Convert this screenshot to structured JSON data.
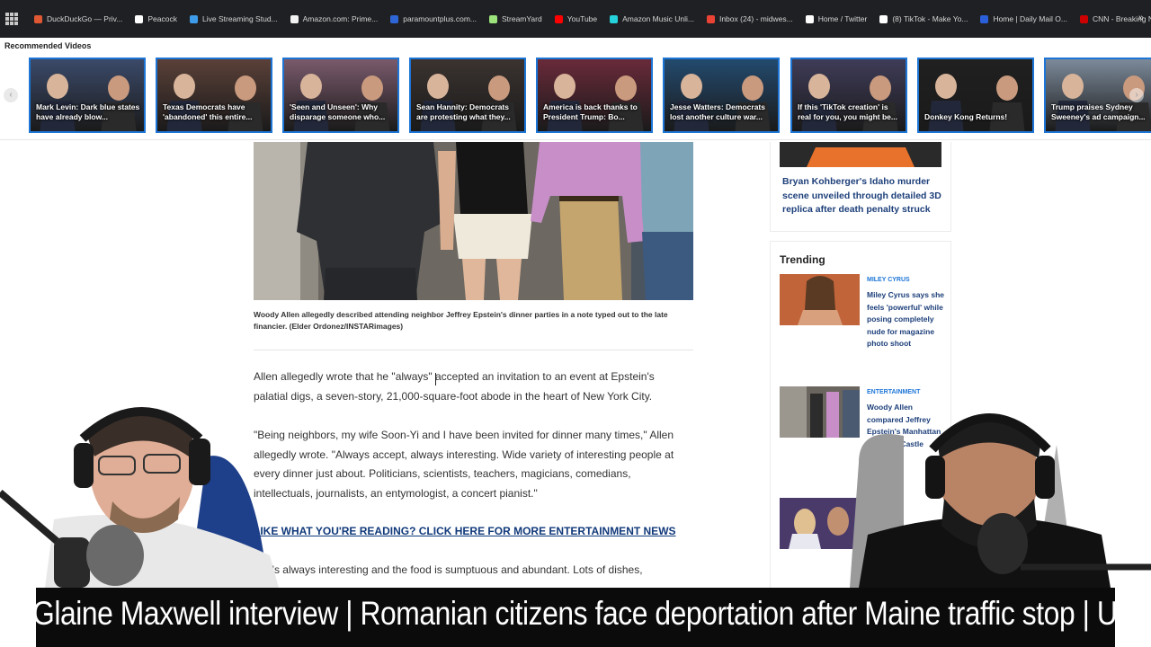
{
  "bookmarks": [
    {
      "label": "DuckDuckGo — Priv...",
      "color": "#de5833",
      "icon": "duckduckgo-icon"
    },
    {
      "label": "Peacock",
      "color": "#ffffff",
      "icon": "peacock-icon"
    },
    {
      "label": "Live Streaming Stud...",
      "color": "#3d9be9",
      "icon": "streaming-studio-icon"
    },
    {
      "label": "Amazon.com: Prime...",
      "color": "#f2f2f2",
      "icon": "amazon-icon"
    },
    {
      "label": "paramountplus.com...",
      "color": "#2f66d6",
      "icon": "paramount-icon"
    },
    {
      "label": "StreamYard",
      "color": "#9be37a",
      "icon": "streamyard-icon"
    },
    {
      "label": "YouTube",
      "color": "#ff0000",
      "icon": "youtube-icon"
    },
    {
      "label": "Amazon Music Unli...",
      "color": "#25d1da",
      "icon": "amazon-music-icon"
    },
    {
      "label": "Inbox (24) - midwes...",
      "color": "#ea4335",
      "icon": "gmail-icon"
    },
    {
      "label": "Home / Twitter",
      "color": "#ffffff",
      "icon": "x-icon"
    },
    {
      "label": "(8) TikTok - Make Yo...",
      "color": "#ffffff",
      "icon": "tiktok-icon"
    },
    {
      "label": "Home | Daily Mail O...",
      "color": "#2b5fd9",
      "icon": "dailymail-icon"
    },
    {
      "label": "CNN - Breaking Ne...",
      "color": "#cc0000",
      "icon": "cnn-icon"
    }
  ],
  "recommended": {
    "title": "Recommended Videos",
    "items": [
      {
        "caption": "Mark Levin: Dark blue states have already blow...",
        "bg": "#3b4a6a"
      },
      {
        "caption": "Texas Democrats have 'abandoned' this entire...",
        "bg": "#5a4038"
      },
      {
        "caption": "'Seen and Unseen': Why disparage someone who...",
        "bg": "#7a5a6c"
      },
      {
        "caption": "Sean Hannity: Democrats are protesting what they...",
        "bg": "#3b3330"
      },
      {
        "caption": "America is back thanks to President Trump: Bo...",
        "bg": "#6a2a3a"
      },
      {
        "caption": "Jesse Watters: Democrats lost another culture war...",
        "bg": "#234a6e"
      },
      {
        "caption": "If this 'TikTok creation' is real for you, you might be...",
        "bg": "#3f3c58"
      },
      {
        "caption": "Donkey Kong Returns!",
        "bg": "#202020"
      },
      {
        "caption": "Trump praises Sydney Sweeney's ad campaign...",
        "bg": "#7c8a9a"
      }
    ]
  },
  "article": {
    "caption": "Woody Allen allegedly described attending neighbor Jeffrey Epstein's dinner parties in a note typed out to the late financier. (Elder Ordonez/INSTARimages)",
    "p1": "Allen allegedly wrote that he \"always\" accepted an invitation to an event at Epstein's palatial digs, a seven-story, 21,000-square-foot abode in the heart of New York City.",
    "p2": "\"Being neighbors, my wife Soon-Yi and I have been invited for dinner many times,\" Allen allegedly wrote. \"Always accept, always interesting. Wide variety of interesting people at every dinner just about. Politicians, scientists, teachers, magicians, comedians, intellectuals, journalists, an entymologist, a concert pianist.\"",
    "cta": "LIKE WHAT YOU'RE READING? CLICK HERE FOR MORE ENTERTAINMENT NEWS",
    "p3": "w, it's always interesting and the food is sumptuous and abundant. Lots of dishes,"
  },
  "sidebar": {
    "top_headline": "Bryan Kohberger's Idaho murder scene unveiled through detailed 3D replica after death penalty struck",
    "trending_title": "Trending",
    "items": [
      {
        "category": "MILEY CYRUS",
        "headline": "Miley Cyrus says she feels 'powerful' while posing completely nude for magazine photo shoot"
      },
      {
        "category": "ENTERTAINMENT",
        "headline": "Woody Allen compared Jeffrey Epstein's Manhattan home to 'Castle"
      }
    ]
  },
  "ticker": {
    "text": "Glaine Maxwell interview  |  Romanian citizens face deportation after Maine traffic stop  |  US ally intercepts Chinese"
  },
  "colors": {
    "bookmark_bar": "#1f2023",
    "thumb_border": "#1d75d6",
    "link": "#1d3f7a",
    "cta": "#10397a",
    "ticker_bg": "#0b0b0b"
  }
}
